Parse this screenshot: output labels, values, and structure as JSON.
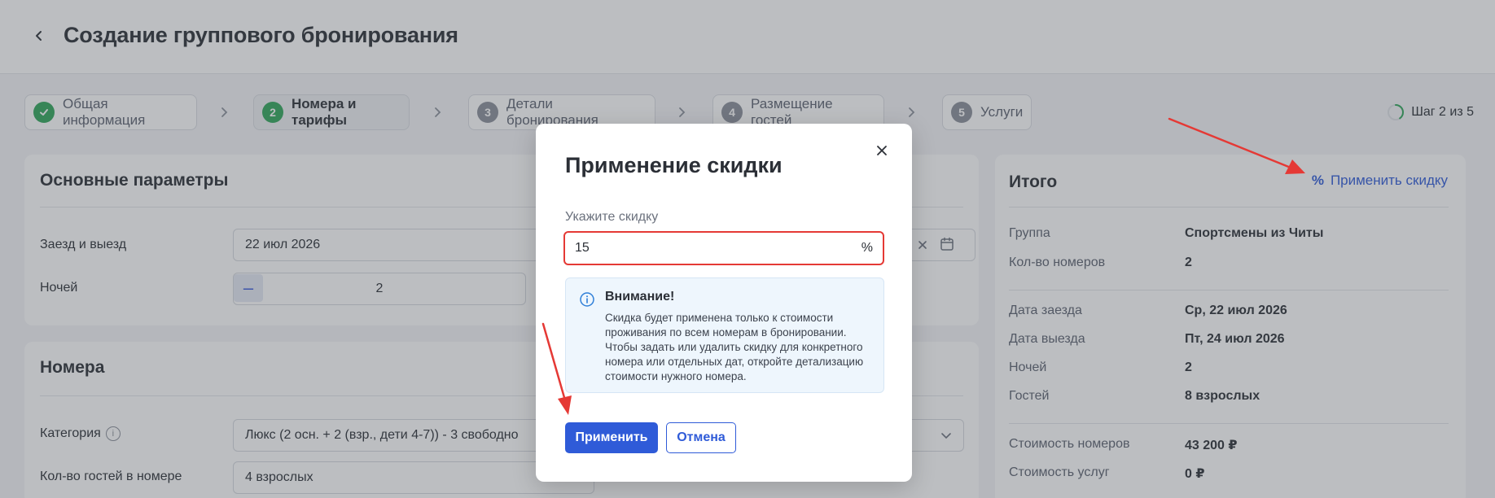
{
  "header": {
    "title": "Создание группового бронирования"
  },
  "stepper": {
    "steps": [
      {
        "num": "",
        "label": "Общая информация",
        "state": "done"
      },
      {
        "num": "2",
        "label": "Номера и тарифы",
        "state": "active"
      },
      {
        "num": "3",
        "label": "Детали бронирования",
        "state": "todo"
      },
      {
        "num": "4",
        "label": "Размещение гостей",
        "state": "todo"
      },
      {
        "num": "5",
        "label": "Услуги",
        "state": "todo"
      }
    ],
    "progress": "Шаг 2 из 5",
    "current_step": 2,
    "total_steps": 5
  },
  "params": {
    "title": "Основные параметры",
    "dates_label": "Заезд и выезд",
    "dates_value": "22 июл 2026",
    "nights_label": "Ночей",
    "nights_value": "2",
    "minus": "–"
  },
  "rooms": {
    "title": "Номера",
    "category_label": "Категория",
    "category_value": "Люкс (2 осн. + 2 (взр., дети 4-7)) - 3 свободно",
    "guests_label": "Кол-во гостей в номере",
    "guests_value": "4 взрослых"
  },
  "summary": {
    "title": "Итого",
    "apply_discount": "Применить скидку",
    "group_label": "Группа",
    "group_value": "Спортсмены из Читы",
    "rooms_count_label": "Кол-во номеров",
    "rooms_count_value": "2",
    "checkin_label": "Дата заезда",
    "checkin_value": "Ср, 22 июл 2026",
    "checkout_label": "Дата выезда",
    "checkout_value": "Пт, 24 июл 2026",
    "nights_label": "Ночей",
    "nights_value": "2",
    "guests_label": "Гостей",
    "guests_value": "8 взрослых",
    "rooms_cost_label": "Стоимость номеров",
    "rooms_cost_value": "43 200 ₽",
    "services_cost_label": "Стоимость услуг",
    "services_cost_value": "0 ₽"
  },
  "modal": {
    "title": "Применение скидки",
    "discount_label": "Укажите скидку",
    "discount_value": "15",
    "discount_suffix": "%",
    "notice_title": "Внимание!",
    "notice_text": "Скидка будет применена только к стоимости проживания по всем номерам в бронировании. Чтобы задать или удалить скидку для конкретного номера или отдельных дат, откройте детализацию стоимости нужного номера.",
    "apply_button": "Применить",
    "cancel_button": "Отмена"
  },
  "colors": {
    "accent": "#2f5bd8",
    "success": "#2fa65a",
    "error": "#e53935",
    "notice_bg": "#eef6fd",
    "annotation": "#e53935"
  },
  "icons": {
    "back": "chevron-left-icon",
    "done_step": "check-icon",
    "close": "close-icon",
    "info": "info-icon",
    "calendar": "calendar-icon",
    "dropdown": "chevron-down-icon",
    "percent": "percent-icon"
  }
}
